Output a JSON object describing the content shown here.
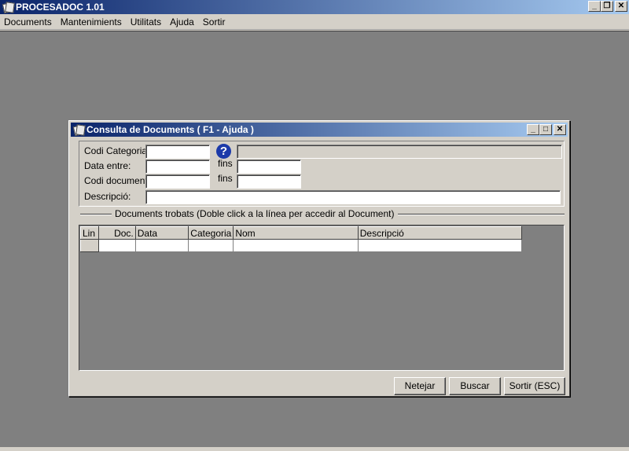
{
  "app": {
    "title": "PROCESADOC 1.01",
    "window_buttons": {
      "minimize": "_",
      "restore": "❐",
      "close": "✕"
    }
  },
  "menubar": {
    "items": [
      "Documents",
      "Mantenimients",
      "Utilitats",
      "Ajuda",
      "Sortir"
    ]
  },
  "dialog": {
    "title": "Consulta de Documents ( F1 - Ajuda )",
    "window_buttons": {
      "minimize": "_",
      "maximize": "□",
      "close": "✕"
    },
    "form": {
      "codi_categoria_label": "Codi Categoria:",
      "data_entre_label": "Data entre:",
      "codi_document_label": "Codi document:",
      "descripcio_label": "Descripció:",
      "fins_label_1": "fins",
      "fins_label_2": "fins",
      "help_glyph": "?",
      "codi_categoria_value": "",
      "data_entre_value": "",
      "data_fins_value": "",
      "codi_document_value": "",
      "codi_document_fins_value": "",
      "descripcio_value": "",
      "categoria_name_value": ""
    },
    "group_label": "Documents trobats (Doble click a la línea per accedir al Document)",
    "grid": {
      "columns": [
        "Lin",
        "Doc.",
        "Data",
        "Categoria",
        "Nom",
        "Descripció"
      ],
      "rows": [
        [
          "",
          "",
          "",
          "",
          "",
          ""
        ]
      ]
    },
    "buttons": {
      "netejar": "Netejar",
      "buscar": "Buscar",
      "sortir": "Sortir (ESC)"
    }
  },
  "colors": {
    "titlebar_start": "#0a246a",
    "titlebar_end": "#a6caf0",
    "workspace": "#808080",
    "face": "#d4d0c8",
    "help_icon": "#1c3aa9"
  },
  "icons": {
    "app": "document-stack-icon",
    "help": "question-circle-icon"
  }
}
